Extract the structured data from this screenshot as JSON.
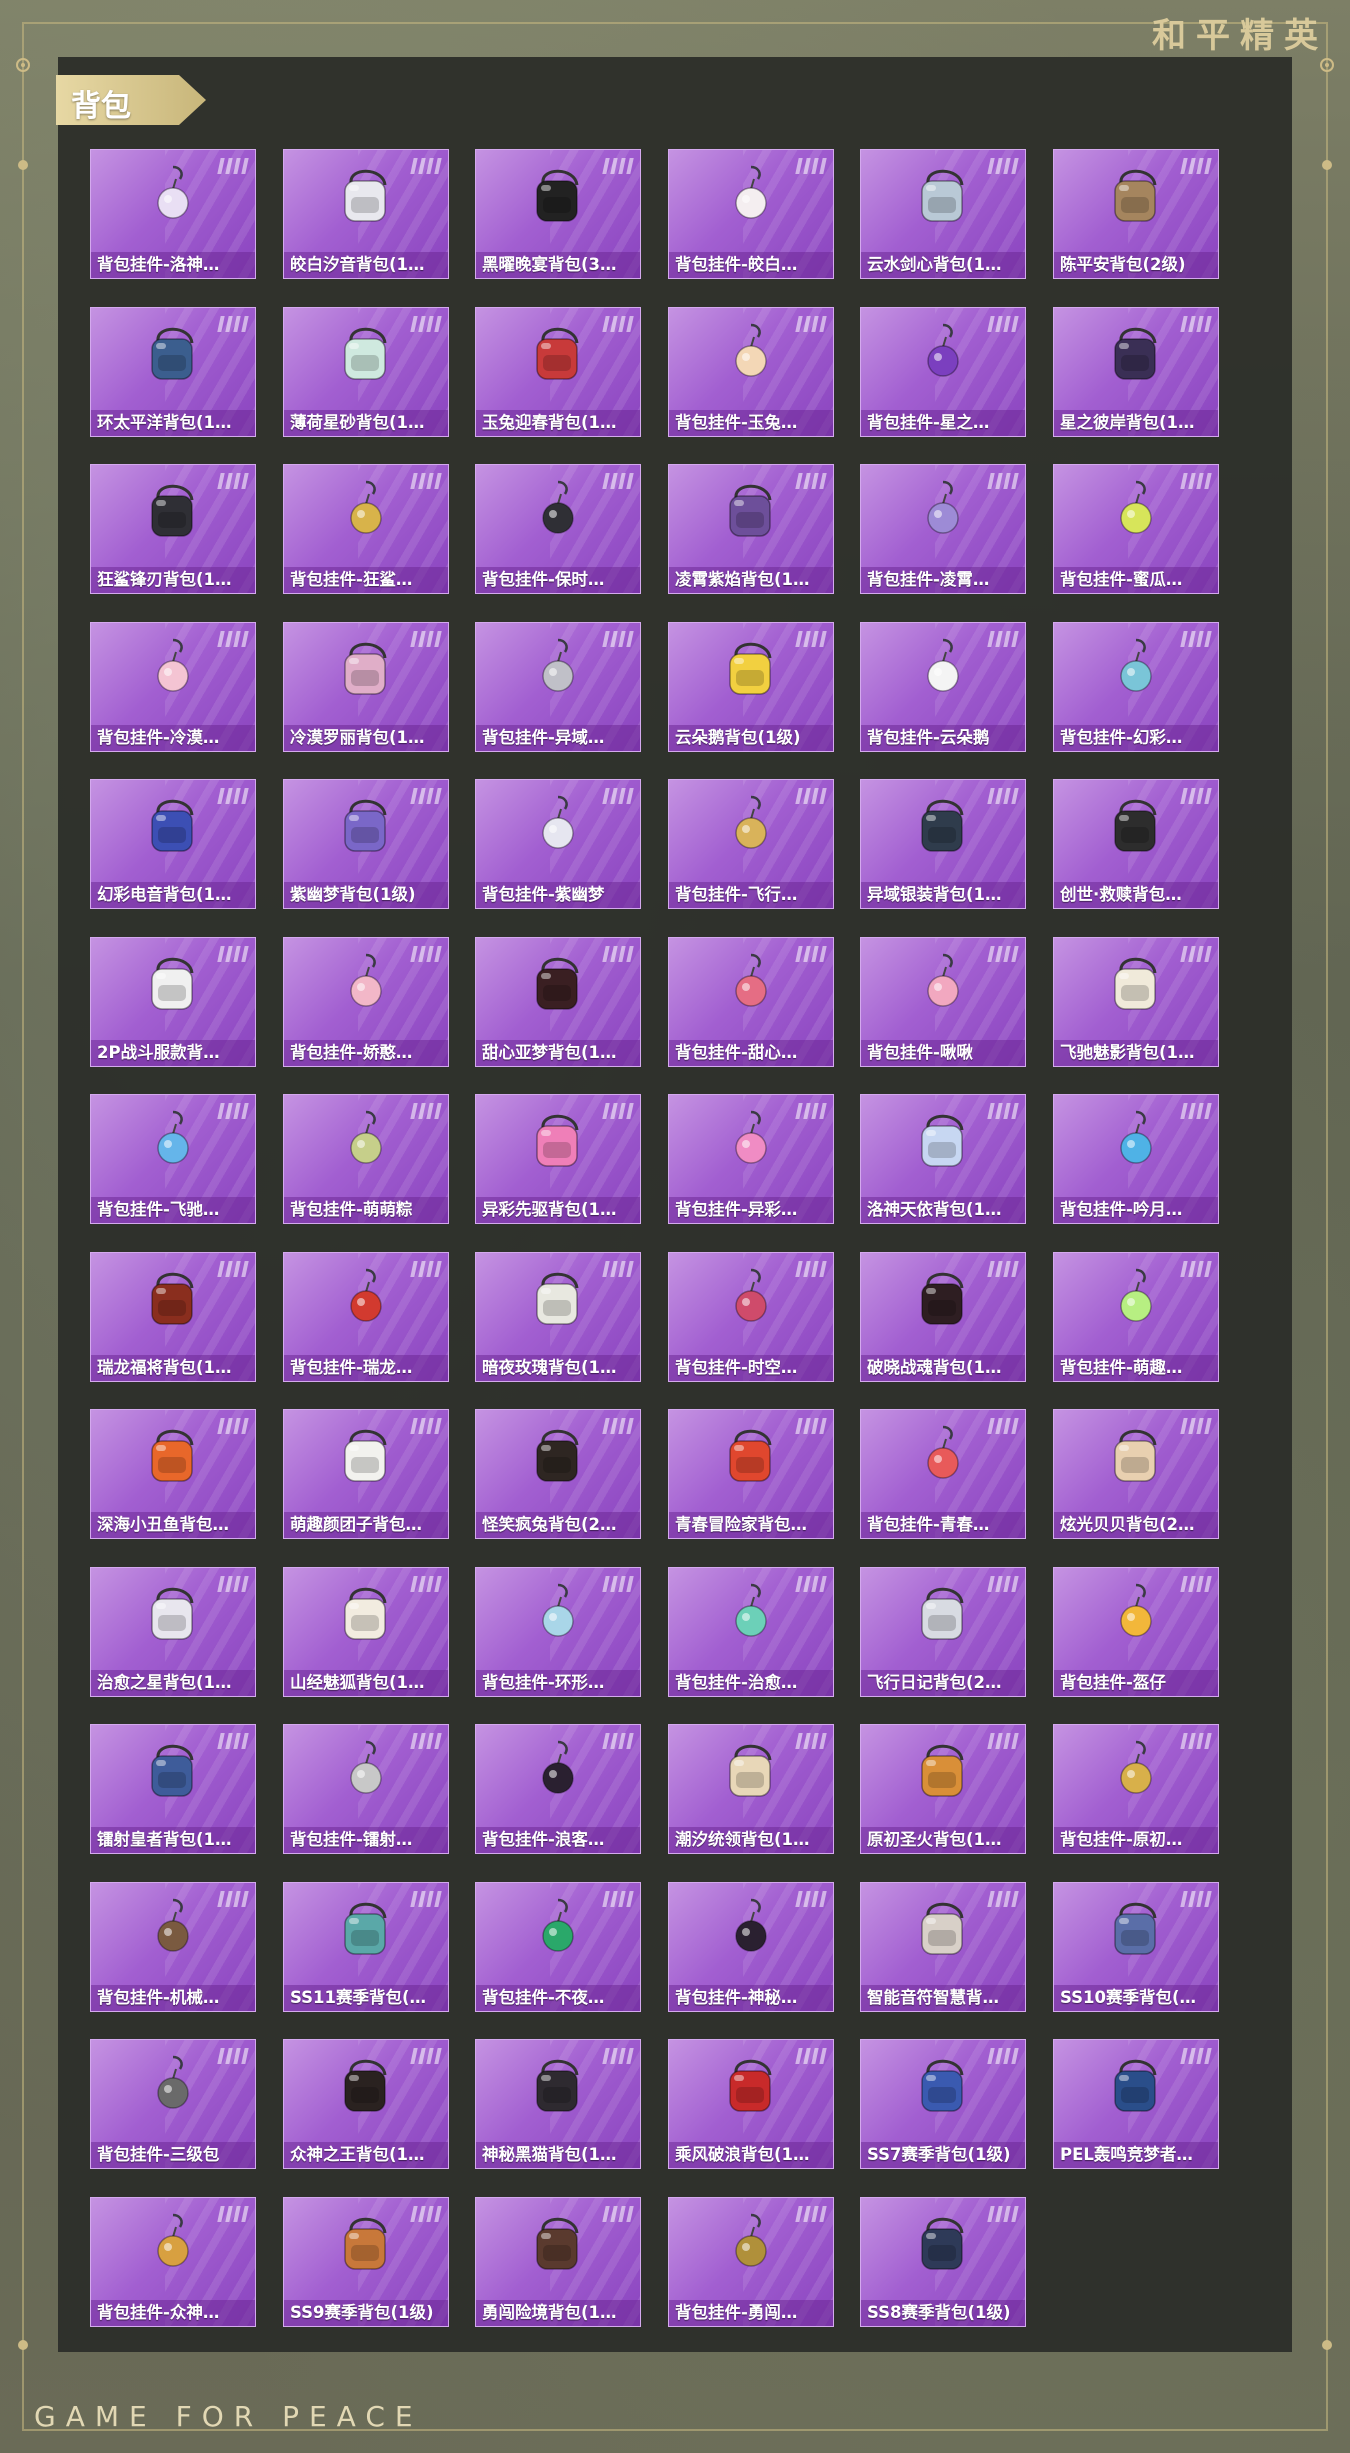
{
  "brand": "和平精英",
  "footer": "GAME FOR PEACE",
  "section_title": "背包",
  "items": [
    {
      "label": "背包挂件-洛神…",
      "icon": "charm-ribbon-icon",
      "color": "#e9dff4"
    },
    {
      "label": "皎白汐音背包(1…",
      "icon": "backpack-pearl-icon",
      "color": "#e8e8ee"
    },
    {
      "label": "黑曜晚宴背包(3…",
      "icon": "backpack-black-cat-icon",
      "color": "#222"
    },
    {
      "label": "背包挂件-皎白…",
      "icon": "charm-seahorse-icon",
      "color": "#f4eef0"
    },
    {
      "label": "云水剑心背包(1…",
      "icon": "backpack-sword-icon",
      "color": "#b9c9d6"
    },
    {
      "label": "陈平安背包(2级)",
      "icon": "backpack-basket-icon",
      "color": "#a5855e"
    },
    {
      "label": "环太平洋背包(1…",
      "icon": "backpack-mech-icon",
      "color": "#3b5e8e"
    },
    {
      "label": "薄荷星砂背包(1…",
      "icon": "backpack-mint-icon",
      "color": "#cfe9df"
    },
    {
      "label": "玉兔迎春背包(1…",
      "icon": "backpack-red-icon",
      "color": "#c83a3a"
    },
    {
      "label": "背包挂件-玉兔…",
      "icon": "charm-rabbit-icon",
      "color": "#f3d7b6"
    },
    {
      "label": "背包挂件-星之…",
      "icon": "charm-planet-icon",
      "color": "#7b3fbf"
    },
    {
      "label": "星之彼岸背包(1…",
      "icon": "backpack-space-icon",
      "color": "#3a2f55"
    },
    {
      "label": "狂鲨锋刃背包(1…",
      "icon": "backpack-shark-icon",
      "color": "#2f2f35"
    },
    {
      "label": "背包挂件-狂鲨…",
      "icon": "charm-fin-icon",
      "color": "#d8b34a"
    },
    {
      "label": "背包挂件-保时…",
      "icon": "charm-key-icon",
      "color": "#2f2f35"
    },
    {
      "label": "凌霄紫焰背包(1…",
      "icon": "backpack-purple-flame-icon",
      "color": "#6d4f9a"
    },
    {
      "label": "背包挂件-凌霄…",
      "icon": "charm-serpent-icon",
      "color": "#9d8bd6"
    },
    {
      "label": "背包挂件-蜜瓜…",
      "icon": "charm-popsicle-icon",
      "color": "#d7e55a"
    },
    {
      "label": "背包挂件-冷漠…",
      "icon": "charm-rose-icon",
      "color": "#f4c4d3"
    },
    {
      "label": "冷漠罗丽背包(1…",
      "icon": "backpack-bow-icon",
      "color": "#e0aec8"
    },
    {
      "label": "背包挂件-异域…",
      "icon": "charm-wing-icon",
      "color": "#c0c0c8"
    },
    {
      "label": "云朵鹅背包(1级)",
      "icon": "backpack-flower-icon",
      "color": "#f2d040"
    },
    {
      "label": "背包挂件-云朵鹅",
      "icon": "charm-goose-icon",
      "color": "#f4f4f4"
    },
    {
      "label": "背包挂件-幻彩…",
      "icon": "charm-robot-icon",
      "color": "#7ac5d8"
    },
    {
      "label": "幻彩电音背包(1…",
      "icon": "backpack-neon-icon",
      "color": "#3c4fb4"
    },
    {
      "label": "紫幽梦背包(1级)",
      "icon": "backpack-bunny-icon",
      "color": "#7a67c8"
    },
    {
      "label": "背包挂件-紫幽梦",
      "icon": "charm-bell-icon",
      "color": "#e6e6f0"
    },
    {
      "label": "背包挂件-飞行…",
      "icon": "charm-plane-icon",
      "color": "#d9b35a"
    },
    {
      "label": "异域银装背包(1…",
      "icon": "backpack-silver-icon",
      "color": "#2f3c4c"
    },
    {
      "label": "创世·救赎背包…",
      "icon": "backpack-genesis-icon",
      "color": "#2d2d2d"
    },
    {
      "label": "2P战斗服款背…",
      "icon": "backpack-white-bunny-icon",
      "color": "#f0f0f0"
    },
    {
      "label": "背包挂件-娇憨…",
      "icon": "charm-pig-icon",
      "color": "#f2b7c8"
    },
    {
      "label": "甜心亚梦背包(1…",
      "icon": "backpack-sweetheart-icon",
      "color": "#3a1f22"
    },
    {
      "label": "背包挂件-甜心…",
      "icon": "charm-paw-icon",
      "color": "#e56d84"
    },
    {
      "label": "背包挂件-啾啾",
      "icon": "charm-bird-icon",
      "color": "#f2a8c0"
    },
    {
      "label": "飞驰魅影背包(1…",
      "icon": "backpack-phantom-icon",
      "color": "#f0eada"
    },
    {
      "label": "背包挂件-飞驰…",
      "icon": "charm-wings-orb-icon",
      "color": "#65b5ea"
    },
    {
      "label": "背包挂件-萌萌粽",
      "icon": "charm-zongzi-icon",
      "color": "#c6cf8a"
    },
    {
      "label": "异彩先驱背包(1…",
      "icon": "backpack-colorful-icon",
      "color": "#ef7fb8"
    },
    {
      "label": "背包挂件-异彩…",
      "icon": "charm-skate-icon",
      "color": "#f08cc4"
    },
    {
      "label": "洛神天依背包(1…",
      "icon": "backpack-luoshen-icon",
      "color": "#c7d7f2"
    },
    {
      "label": "背包挂件-吟月…",
      "icon": "charm-tassel-icon",
      "color": "#4fb2e6"
    },
    {
      "label": "瑞龙福将背包(1…",
      "icon": "backpack-dragon-icon",
      "color": "#8a2e1e"
    },
    {
      "label": "背包挂件-瑞龙…",
      "icon": "charm-lantern-icon",
      "color": "#d23a2f"
    },
    {
      "label": "暗夜玫瑰背包(1…",
      "icon": "backpack-rose-icon",
      "color": "#e8e8e0"
    },
    {
      "label": "背包挂件-时空…",
      "icon": "charm-crown-icon",
      "color": "#cf4b6b"
    },
    {
      "label": "破晓战魂背包(1…",
      "icon": "backpack-dawn-icon",
      "color": "#2e1e22"
    },
    {
      "label": "背包挂件-萌趣…",
      "icon": "charm-slime-icon",
      "color": "#b7ef82"
    },
    {
      "label": "深海小丑鱼背包…",
      "icon": "backpack-clownfish-icon",
      "color": "#e8672a"
    },
    {
      "label": "萌趣颜团子背包…",
      "icon": "backpack-dumpling-icon",
      "color": "#f2f2ee"
    },
    {
      "label": "怪笑疯兔背包(2…",
      "icon": "backpack-crazy-rabbit-icon",
      "color": "#2e2622"
    },
    {
      "label": "青春冒险家背包…",
      "icon": "backpack-adventurer-icon",
      "color": "#e0472e"
    },
    {
      "label": "背包挂件-青春…",
      "icon": "charm-dino-icon",
      "color": "#e85a5a"
    },
    {
      "label": "炫光贝贝背包(2…",
      "icon": "backpack-doll-icon",
      "color": "#e8d0b0"
    },
    {
      "label": "治愈之星背包(1…",
      "icon": "backpack-star-icon",
      "color": "#e8e6ee"
    },
    {
      "label": "山经魅狐背包(1…",
      "icon": "backpack-fox-icon",
      "color": "#f2ece0"
    },
    {
      "label": "背包挂件-环形…",
      "icon": "charm-ring-icon",
      "color": "#a9d6e8"
    },
    {
      "label": "背包挂件-治愈…",
      "icon": "charm-cup-icon",
      "color": "#6cd0b8"
    },
    {
      "label": "飞行日记背包(2…",
      "icon": "backpack-flight-icon",
      "color": "#d8dbe2"
    },
    {
      "label": "背包挂件-盔仔",
      "icon": "charm-helmet-icon",
      "color": "#f2b73a"
    },
    {
      "label": "镭射皇者背包(1…",
      "icon": "backpack-laser-icon",
      "color": "#3e5c9a"
    },
    {
      "label": "背包挂件-镭射…",
      "icon": "charm-headphone-icon",
      "color": "#c8c8c8"
    },
    {
      "label": "背包挂件-浪客…",
      "icon": "charm-witch-icon",
      "color": "#2a2030"
    },
    {
      "label": "潮汐统领背包(1…",
      "icon": "backpack-tide-icon",
      "color": "#e8d7b8"
    },
    {
      "label": "原初圣火背包(1…",
      "icon": "backpack-fire-icon",
      "color": "#d98f38"
    },
    {
      "label": "背包挂件-原初…",
      "icon": "charm-emblem-icon",
      "color": "#d8b04a"
    },
    {
      "label": "背包挂件-机械…",
      "icon": "charm-mech-icon",
      "color": "#7a5a40"
    },
    {
      "label": "SS11赛季背包(…",
      "icon": "backpack-ss11-icon",
      "color": "#5aa8a8"
    },
    {
      "label": "背包挂件-不夜…",
      "icon": "charm-jade-icon",
      "color": "#2aa86a"
    },
    {
      "label": "背包挂件-神秘…",
      "icon": "charm-cat-icon",
      "color": "#2a2030"
    },
    {
      "label": "智能音符智慧背…",
      "icon": "backpack-music-icon",
      "color": "#d8d0c8"
    },
    {
      "label": "SS10赛季背包(…",
      "icon": "backpack-ss10-icon",
      "color": "#5a6ea8"
    },
    {
      "label": "背包挂件-三级包",
      "icon": "charm-level3-icon",
      "color": "#6a6a6a"
    },
    {
      "label": "众神之王背包(1…",
      "icon": "backpack-god-icon",
      "color": "#2a2220"
    },
    {
      "label": "神秘黑猫背包(1…",
      "icon": "backpack-black-cat2-icon",
      "color": "#2e2a30"
    },
    {
      "label": "乘风破浪背包(1…",
      "icon": "backpack-heart-icon",
      "color": "#c82a2a"
    },
    {
      "label": "SS7赛季背包(1级)",
      "icon": "backpack-ss7-icon",
      "color": "#3a5ab0"
    },
    {
      "label": "PEL轰鸣竞梦者…",
      "icon": "backpack-pel-icon",
      "color": "#2a4e8a"
    },
    {
      "label": "背包挂件-众神…",
      "icon": "charm-thunder-icon",
      "color": "#d8a040"
    },
    {
      "label": "SS9赛季背包(1级)",
      "icon": "backpack-ss9-icon",
      "color": "#c8783a"
    },
    {
      "label": "勇闯险境背包(1…",
      "icon": "backpack-explorer-icon",
      "color": "#5a3a2e"
    },
    {
      "label": "背包挂件-勇闯…",
      "icon": "charm-chest-icon",
      "color": "#b0903a"
    },
    {
      "label": "SS8赛季背包(1级)",
      "icon": "backpack-ss8-icon",
      "color": "#2e3a58"
    }
  ]
}
